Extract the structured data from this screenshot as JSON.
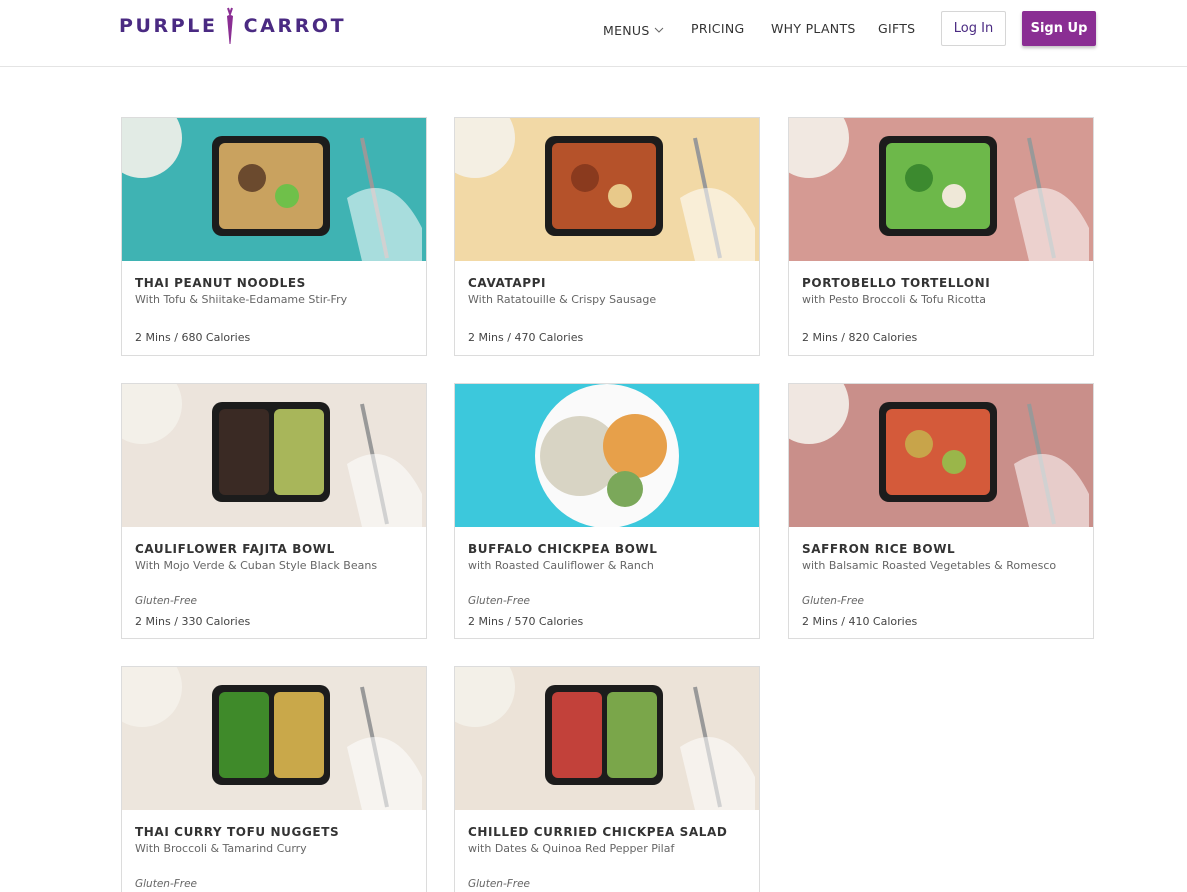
{
  "brand": {
    "name_left": "PURPLE",
    "name_right": "CARROT",
    "color": "#4a2a82",
    "accent": "#8a2e93"
  },
  "nav": {
    "items": [
      {
        "label": "MENUS",
        "has_dropdown": true
      },
      {
        "label": "PRICING"
      },
      {
        "label": "WHY PLANTS"
      },
      {
        "label": "GIFTS"
      }
    ],
    "login_label": "Log In",
    "signup_label": "Sign Up"
  },
  "meals": [
    {
      "title": "THAI PEANUT NOODLES",
      "subtitle": "With Tofu & Shiitake-Edamame Stir-Fry",
      "tag": "",
      "meta": "2 Mins / 680 Calories",
      "bg": "#3fb3b3"
    },
    {
      "title": "CAVATAPPI",
      "subtitle": "With Ratatouille & Crispy Sausage",
      "tag": "",
      "meta": "2 Mins / 470 Calories",
      "bg": "#f2d9a6"
    },
    {
      "title": "PORTOBELLO TORTELLONI",
      "subtitle": "with Pesto Broccoli & Tofu Ricotta",
      "tag": "",
      "meta": "2 Mins / 820 Calories",
      "bg": "#d59a93"
    },
    {
      "title": "CAULIFLOWER FAJITA BOWL",
      "subtitle": "With Mojo Verde & Cuban Style Black Beans",
      "tag": "Gluten-Free",
      "meta": "2 Mins / 330 Calories",
      "bg": "#ece4dc"
    },
    {
      "title": "BUFFALO CHICKPEA BOWL",
      "subtitle": "with Roasted Cauliflower & Ranch",
      "tag": "Gluten-Free",
      "meta": "2 Mins / 570 Calories",
      "bg": "#3cc8dc"
    },
    {
      "title": "SAFFRON RICE BOWL",
      "subtitle": "with Balsamic Roasted Vegetables & Romesco",
      "tag": "Gluten-Free",
      "meta": "2 Mins / 410 Calories",
      "bg": "#c98f8a"
    },
    {
      "title": "THAI CURRY TOFU NUGGETS",
      "subtitle": "With Broccoli & Tamarind Curry",
      "tag": "Gluten-Free",
      "meta": "",
      "bg": "#ede6dd"
    },
    {
      "title": "CHILLED CURRIED CHICKPEA SALAD",
      "subtitle": "with Dates & Quinoa Red Pepper Pilaf",
      "tag": "Gluten-Free",
      "meta": "",
      "bg": "#ece3d8"
    }
  ]
}
